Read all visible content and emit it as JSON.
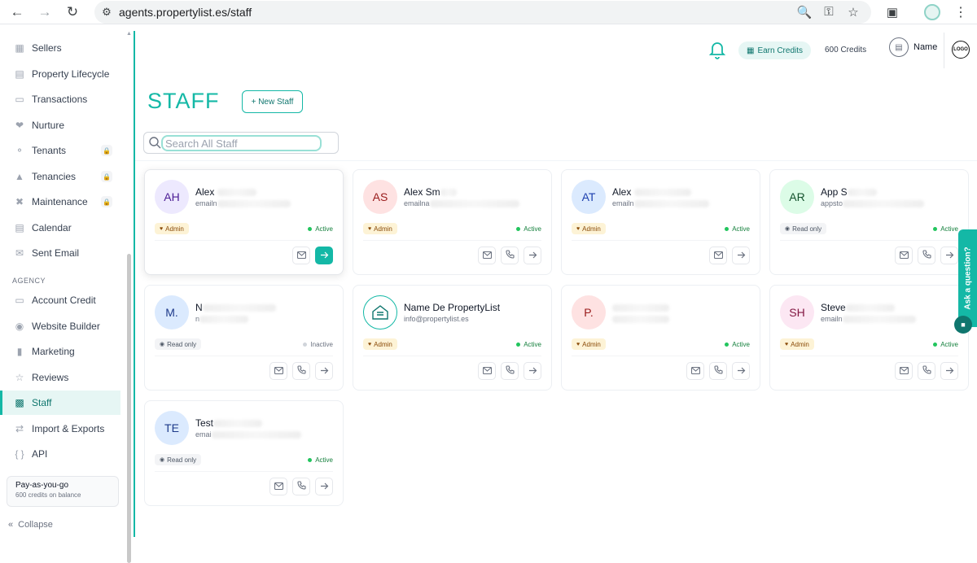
{
  "browser": {
    "url": "agents.propertylist.es/staff"
  },
  "sidebar": {
    "items": [
      {
        "label": "Sellers",
        "icon": "sellers-icon",
        "locked": false
      },
      {
        "label": "Property Lifecycle",
        "icon": "chart-icon",
        "locked": false
      },
      {
        "label": "Transactions",
        "icon": "document-icon",
        "locked": false
      },
      {
        "label": "Nurture",
        "icon": "heart-icon",
        "locked": false
      },
      {
        "label": "Tenants",
        "icon": "key-icon",
        "locked": true
      },
      {
        "label": "Tenancies",
        "icon": "building-icon",
        "locked": true
      },
      {
        "label": "Maintenance",
        "icon": "tools-icon",
        "locked": true
      },
      {
        "label": "Calendar",
        "icon": "calendar-icon",
        "locked": false
      },
      {
        "label": "Sent Email",
        "icon": "mail-icon",
        "locked": false
      }
    ],
    "section_label": "AGENCY",
    "agency_items": [
      {
        "label": "Account Credit",
        "icon": "credit-card-icon"
      },
      {
        "label": "Website Builder",
        "icon": "globe-icon"
      },
      {
        "label": "Marketing",
        "icon": "video-icon"
      },
      {
        "label": "Reviews",
        "icon": "star-icon"
      },
      {
        "label": "Staff",
        "icon": "staff-icon",
        "active": true
      },
      {
        "label": "Import & Exports",
        "icon": "swap-icon"
      },
      {
        "label": "API",
        "icon": "braces-icon"
      }
    ],
    "plan": {
      "name": "Pay-as-you-go",
      "detail": "600 credits on balance"
    },
    "collapse_label": "Collapse"
  },
  "topbar": {
    "earn_label": "Earn Credits",
    "credits": "600 Credits",
    "user_name": "Name"
  },
  "page": {
    "title": "STAFF",
    "new_button": "+ New Staff",
    "search_placeholder": "Search All Staff"
  },
  "staff": [
    {
      "initials": "AH",
      "name": "Alex ",
      "email": "emailn",
      "role": "Admin",
      "status": "Active",
      "phone": false,
      "highlight": true
    },
    {
      "initials": "AS",
      "name": "Alex Sm",
      "email": "emailna",
      "role": "Admin",
      "status": "Active",
      "phone": true
    },
    {
      "initials": "AT",
      "name": "Alex ",
      "email": "emailn",
      "role": "Admin",
      "status": "Active",
      "phone": false
    },
    {
      "initials": "AR",
      "name": "App S",
      "email": "appsto",
      "role": "Read only",
      "status": "Active",
      "phone": true
    },
    {
      "initials": "M.",
      "name": "N",
      "email": "n",
      "role": "Read only",
      "status": "Inactive",
      "phone": true
    },
    {
      "initials": "",
      "name": "Name De PropertyList",
      "email": "info@propertylist.es",
      "role": "Admin",
      "status": "Active",
      "phone": true,
      "logo": true
    },
    {
      "initials": "P.",
      "name": "",
      "email": "",
      "role": "Admin",
      "status": "Active",
      "phone": true
    },
    {
      "initials": "SH",
      "name": "Steve",
      "email": "emailn",
      "role": "Admin",
      "status": "Active",
      "phone": true
    },
    {
      "initials": "TE",
      "name": "Test",
      "email": "emai",
      "role": "Read only",
      "status": "Active",
      "phone": true
    }
  ],
  "help_tab": "Ask a question?",
  "colors": {
    "accent": "#14b8a6",
    "accent_dark": "#0f766e",
    "admin_bg": "#fdf3d6",
    "active_green": "#22c55e"
  }
}
